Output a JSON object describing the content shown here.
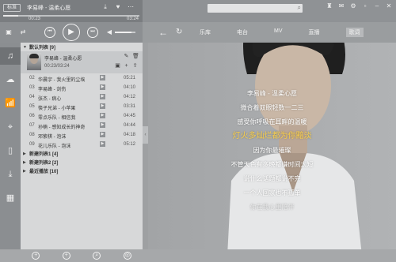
{
  "app": {
    "version_tag": "标准",
    "now_playing": "李易峰 - 温柔心愿",
    "time_elapsed": "00:23",
    "time_total": "03:24",
    "progress": 0.11,
    "volume": 0.8
  },
  "search": {
    "placeholder": ""
  },
  "nav": {
    "tabs": [
      "乐库",
      "电台",
      "MV",
      "直播",
      "歌词"
    ],
    "active_tab": "歌词"
  },
  "rail": {
    "items": [
      {
        "name": "music",
        "icon": "music-note-icon"
      },
      {
        "name": "cloud",
        "icon": "cloud-icon"
      },
      {
        "name": "radio",
        "icon": "radio-icon"
      },
      {
        "name": "location",
        "icon": "location-pin-icon"
      },
      {
        "name": "phone",
        "icon": "phone-icon"
      },
      {
        "name": "download",
        "icon": "download-icon"
      },
      {
        "name": "apps",
        "icon": "apps-grid-icon"
      }
    ]
  },
  "playlist": {
    "default_group": "默认列表 [9]",
    "now_card": {
      "title": "李易峰 - 温柔心愿",
      "time": "00:23/03:24"
    },
    "songs": [
      {
        "num": "02",
        "name": "华晨宇 - 我火里的尘埃",
        "duration": "05:21"
      },
      {
        "num": "03",
        "name": "李易峰 - 剑伤",
        "duration": "04:10"
      },
      {
        "num": "04",
        "name": "张杰 - 病心",
        "duration": "04:12"
      },
      {
        "num": "05",
        "name": "筷子兄弟 - 小苹果",
        "duration": "03:31"
      },
      {
        "num": "06",
        "name": "零点乐队 - 相信我",
        "duration": "04:45"
      },
      {
        "num": "07",
        "name": "孙楠 - 感知成长的神奇",
        "duration": "04:44"
      },
      {
        "num": "08",
        "name": "邓紫棋 - 泡沫",
        "duration": "04:18"
      },
      {
        "num": "09",
        "name": "花儿乐队 - 泡沫",
        "duration": "05:12"
      }
    ],
    "groups": [
      "新建列表1 [4]",
      "新建列表2 [2]",
      "最近播放 [10]"
    ]
  },
  "lyrics": {
    "lines": [
      "李易峰 - 温柔心愿",
      "微合着双眼轻数一二三",
      "感受你呼吸在耳畔的温暖",
      "灯火多灿烂都为你黯淡",
      "因为你最璀璨",
      "不管天色有多晚都嫌时间太短",
      "说什么话题都说不完",
      "一个人回家也不孤单",
      "你在我心里陪伴"
    ],
    "current_index": 3
  },
  "colors": {
    "highlight_lyric": "#fbd04a"
  }
}
